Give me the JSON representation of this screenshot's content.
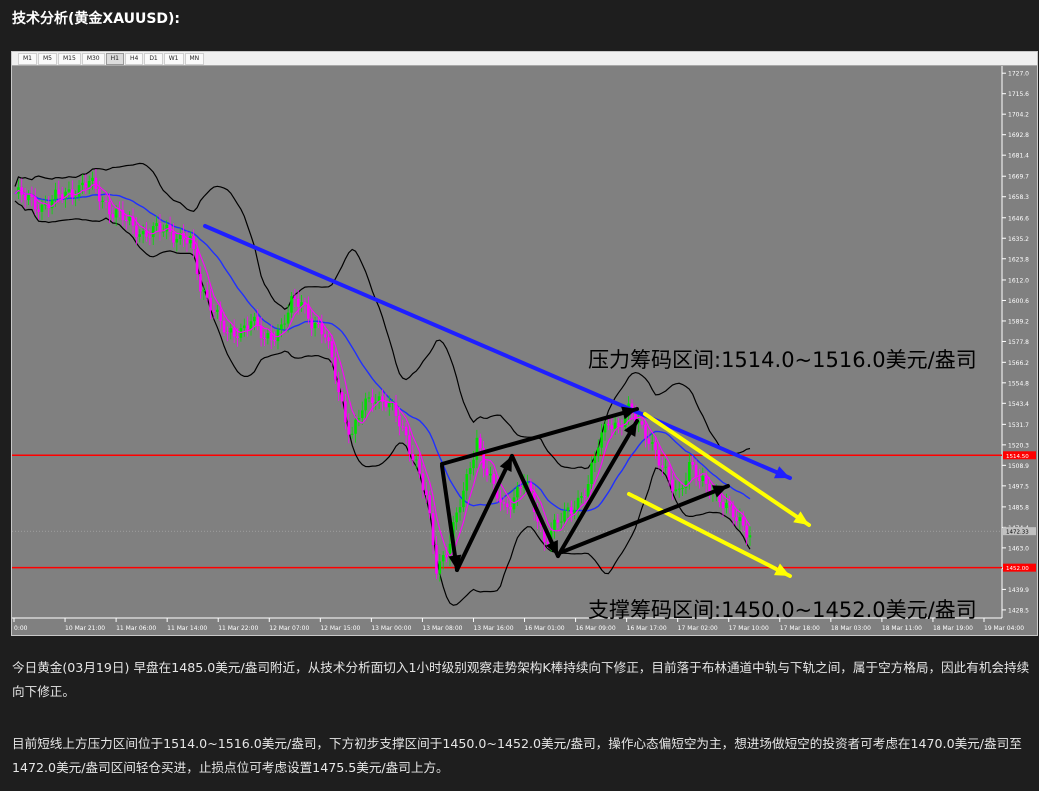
{
  "title": "技术分析(黄金XAUUSD):",
  "toolbar": {
    "timeframes": [
      "M1",
      "M5",
      "M15",
      "M30",
      "H1",
      "H4",
      "D1",
      "W1",
      "MN"
    ],
    "active": "H1"
  },
  "chart_data": {
    "type": "candlestick",
    "symbol": "XAUUSD",
    "timeframe": "H1",
    "y_ticks": [
      1727.0,
      1715.6,
      1704.2,
      1692.8,
      1681.4,
      1669.7,
      1658.3,
      1646.6,
      1635.2,
      1623.8,
      1612.0,
      1600.6,
      1589.2,
      1577.8,
      1566.2,
      1554.8,
      1543.4,
      1531.7,
      1520.3,
      1508.9,
      1497.5,
      1485.8,
      1474.4,
      1463.0,
      1451.6,
      1439.9,
      1428.5
    ],
    "ylim": [
      1424.0,
      1731.0
    ],
    "x_ticks": [
      "0:00",
      "10 Mar 21:00",
      "11 Mar 06:00",
      "11 Mar 14:00",
      "11 Mar 22:00",
      "12 Mar 07:00",
      "12 Mar 15:00",
      "13 Mar 00:00",
      "13 Mar 08:00",
      "13 Mar 16:00",
      "16 Mar 01:00",
      "16 Mar 09:00",
      "16 Mar 17:00",
      "17 Mar 02:00",
      "17 Mar 10:00",
      "17 Mar 18:00",
      "18 Mar 03:00",
      "18 Mar 11:00",
      "18 Mar 19:00",
      "19 Mar 04:00"
    ],
    "horizontal_levels": [
      {
        "price": 1514.5,
        "label": "1514.50",
        "color": "#ff0000"
      },
      {
        "price": 1452.0,
        "label": "1452.00",
        "color": "#ff0000"
      }
    ],
    "current_price": {
      "price": 1472.3,
      "label": "1472.33"
    },
    "anchor_points": [
      [
        0,
        1660
      ],
      [
        8,
        1653
      ],
      [
        15,
        1660
      ],
      [
        22,
        1666
      ],
      [
        28,
        1652
      ],
      [
        34,
        1643
      ],
      [
        38,
        1638
      ],
      [
        45,
        1640
      ],
      [
        52,
        1633
      ],
      [
        55,
        1608
      ],
      [
        58,
        1600
      ],
      [
        63,
        1580
      ],
      [
        67,
        1585
      ],
      [
        70,
        1590
      ],
      [
        74,
        1578
      ],
      [
        79,
        1586
      ],
      [
        82,
        1598
      ],
      [
        85,
        1600
      ],
      [
        88,
        1590
      ],
      [
        92,
        1580
      ],
      [
        95,
        1560
      ],
      [
        98,
        1535
      ],
      [
        100,
        1525
      ],
      [
        103,
        1540
      ],
      [
        106,
        1548
      ],
      [
        110,
        1544
      ],
      [
        113,
        1536
      ],
      [
        116,
        1525
      ],
      [
        119,
        1510
      ],
      [
        122,
        1490
      ],
      [
        125,
        1452
      ],
      [
        128,
        1462
      ],
      [
        131,
        1480
      ],
      [
        134,
        1500
      ],
      [
        137,
        1525
      ],
      [
        139,
        1510
      ],
      [
        142,
        1495
      ],
      [
        145,
        1485
      ],
      [
        148,
        1492
      ],
      [
        151,
        1500
      ],
      [
        154,
        1485
      ],
      [
        157,
        1468
      ],
      [
        160,
        1475
      ],
      [
        163,
        1480
      ],
      [
        167,
        1490
      ],
      [
        170,
        1498
      ],
      [
        173,
        1520
      ],
      [
        176,
        1535
      ],
      [
        179,
        1530
      ],
      [
        182,
        1538
      ],
      [
        185,
        1533
      ],
      [
        188,
        1525
      ],
      [
        191,
        1510
      ],
      [
        194,
        1500
      ],
      [
        197,
        1495
      ],
      [
        200,
        1508
      ],
      [
        203,
        1500
      ],
      [
        206,
        1498
      ],
      [
        209,
        1490
      ],
      [
        212,
        1482
      ],
      [
        215,
        1478
      ],
      [
        218,
        1472
      ]
    ],
    "annotations": [
      {
        "text": "压力筹码区间:1514.0~1516.0美元/盎司"
      },
      {
        "text": "支撑筹码区间:1450.0~1452.0美元/盎司"
      }
    ]
  },
  "paragraphs": [
    "今日黄金(03月19日) 早盘在1485.0美元/盎司附近，从技术分析面切入1小时级别观察走势架构K棒持续向下修正，目前落于布林通道中轨与下轨之间，属于空方格局，因此有机会持续向下修正。",
    "目前短线上方压力区间位于1514.0~1516.0美元/盎司，下方初步支撑区间于1450.0~1452.0美元/盎司，操作心态偏短空为主，想进场做短空的投资者可考虑在1470.0美元/盎司至1472.0美元/盎司区间轻仓买进，止损点位可考虑设置1475.5美元/盎司上方。"
  ]
}
